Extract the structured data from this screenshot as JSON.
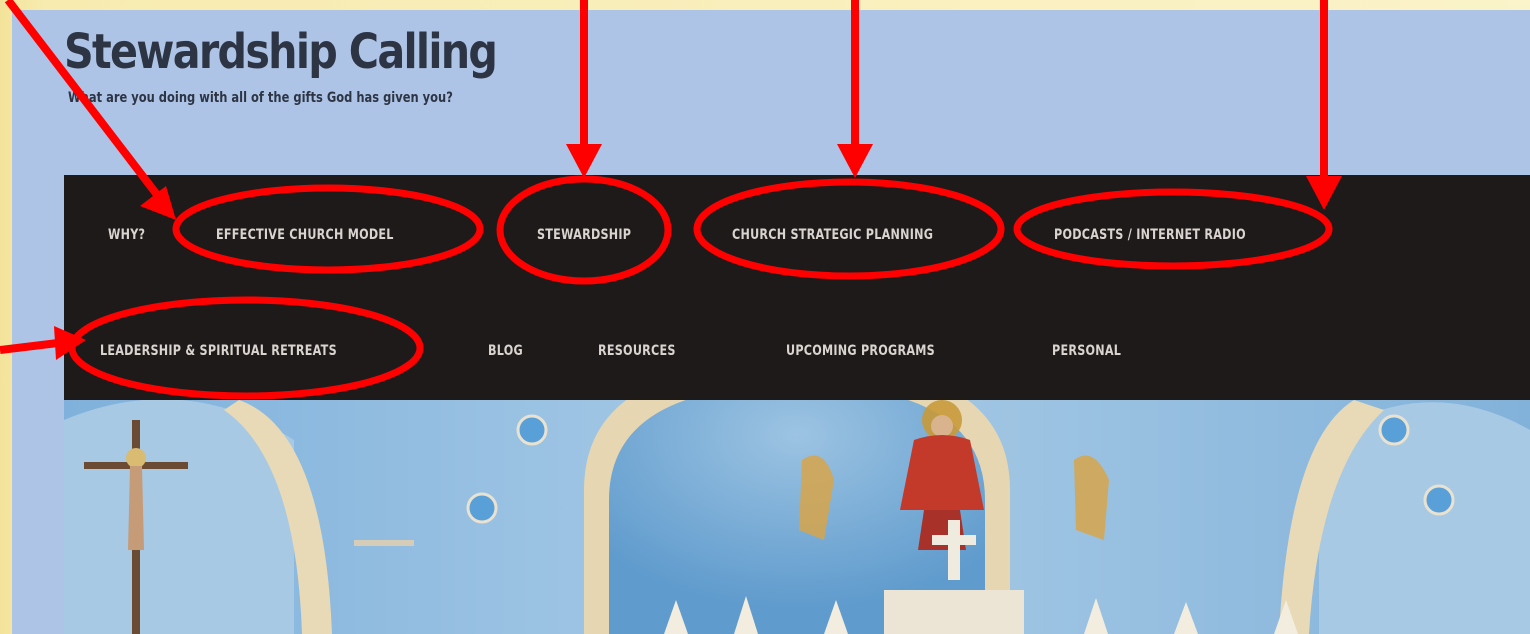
{
  "site": {
    "title": "Stewardship Calling",
    "tagline": "What are you doing with all of the gifts God has given you?"
  },
  "nav": {
    "row1": [
      "WHY?",
      "EFFECTIVE CHURCH MODEL",
      "STEWARDSHIP",
      "CHURCH STRATEGIC PLANNING",
      "PODCASTS / INTERNET RADIO"
    ],
    "row2": [
      "LEADERSHIP & SPIRITUAL RETREATS",
      "BLOG",
      "RESOURCES",
      "UPCOMING PROGRAMS",
      "PERSONAL"
    ]
  },
  "colors": {
    "page_bg": "#aec4e6",
    "navbar_bg": "#1e1a19",
    "nav_text": "#d9d4cf",
    "annotation": "#ff0000",
    "outer_border": "#f5e6a3"
  },
  "hero": {
    "image": "church-altar-interior"
  }
}
